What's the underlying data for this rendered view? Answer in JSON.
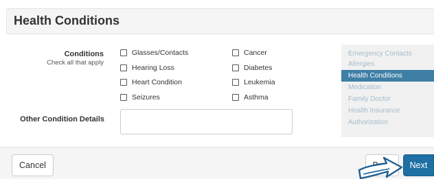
{
  "page": {
    "title": "Health Conditions"
  },
  "form": {
    "conditions_label": "Conditions",
    "conditions_hint": "Check all that apply",
    "conditions": [
      {
        "label": "Glasses/Contacts",
        "checked": false
      },
      {
        "label": "Cancer",
        "checked": false
      },
      {
        "label": "Hearing Loss",
        "checked": false
      },
      {
        "label": "Diabetes",
        "checked": false
      },
      {
        "label": "Heart Condition",
        "checked": false
      },
      {
        "label": "Leukemia",
        "checked": false
      },
      {
        "label": "Seizures",
        "checked": false
      },
      {
        "label": "Asthma",
        "checked": false
      }
    ],
    "other_label": "Other Condition Details",
    "other_value": ""
  },
  "sidebar": {
    "items": [
      {
        "label": "Emergency Contacts",
        "active": false
      },
      {
        "label": "Allergies",
        "active": false
      },
      {
        "label": "Health Conditions",
        "active": true
      },
      {
        "label": "Medication",
        "active": false
      },
      {
        "label": "Family Doctor",
        "active": false
      },
      {
        "label": "Health Insurance",
        "active": false
      },
      {
        "label": "Authorization",
        "active": false
      }
    ]
  },
  "footer": {
    "cancel_label": "Cancel",
    "back_label": "Back",
    "next_label": "Next"
  },
  "colors": {
    "primary": "#1e6fa4",
    "active_nav": "#3f7fa6",
    "inactive_nav_text": "#a4bccc"
  },
  "icons": {
    "pointer": "hand-pointer-icon"
  }
}
